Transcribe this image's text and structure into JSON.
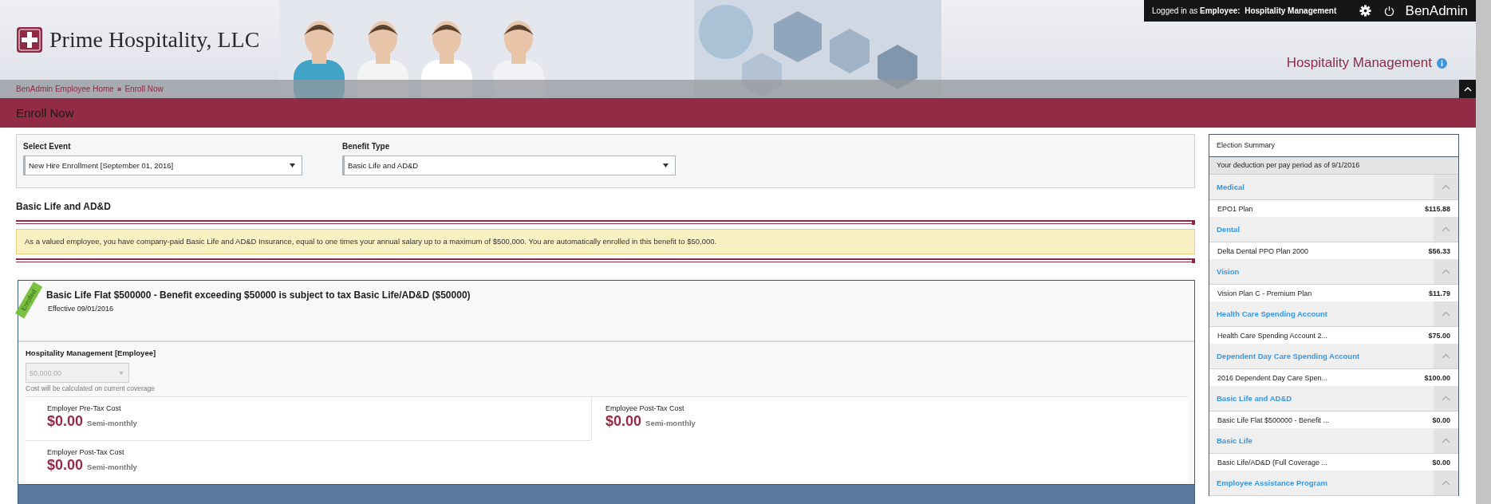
{
  "header": {
    "company": "Prime Hospitality, LLC",
    "login_prefix": "Logged in as",
    "login_role": "Employee:",
    "login_name": "Hospitality Management",
    "brand": "BenAdmin",
    "organization": "Hospitality Management"
  },
  "breadcrumb": {
    "separator": "»",
    "items": [
      {
        "label": "BenAdmin Employee Home"
      },
      {
        "label": "Enroll Now"
      }
    ]
  },
  "page_title": "Enroll Now",
  "filters": [
    {
      "label": "Select Event",
      "value": "New Hire Enrollment [September 01, 2016]"
    },
    {
      "label": "Benefit Type",
      "value": "Basic Life and AD&D"
    }
  ],
  "section_title": "Basic Life and AD&D",
  "notice": "As a valued employee, you have company-paid Basic Life and AD&D Insurance, equal to one times your annual salary up to a maximum of $500,000. You are automatically enrolled in this benefit to $50,000.",
  "plan": {
    "badge": "Enrolled",
    "title": "Basic Life Flat $500000 - Benefit exceeding $50000 is subject to tax Basic Life/AD&D ($50000)",
    "effective": "Effective 09/01/2016",
    "coverage_label": "Hospitality Management [Employee]",
    "coverage": {
      "value": "50,000.00",
      "disabled": true
    },
    "coverage_note": "Cost will be calculated on current coverage",
    "costs": [
      {
        "label": "Employer Pre-Tax Cost",
        "amount": "$0.00",
        "period": "Semi-monthly"
      },
      {
        "label": "Employee Post-Tax Cost",
        "amount": "$0.00",
        "period": "Semi-monthly"
      },
      {
        "label": "Employer Post-Tax Cost",
        "amount": "$0.00",
        "period": "Semi-monthly"
      }
    ]
  },
  "summary": {
    "title": "Election Summary",
    "subtitle": "Your deduction per pay period as of 9/1/2016",
    "groups": [
      {
        "name": "Medical",
        "expanded": true,
        "items": [
          {
            "name": "EPO1 Plan",
            "amount": "$115.88"
          }
        ]
      },
      {
        "name": "Dental",
        "expanded": true,
        "items": [
          {
            "name": "Delta Dental PPO Plan 2000",
            "amount": "$56.33"
          }
        ]
      },
      {
        "name": "Vision",
        "expanded": true,
        "items": [
          {
            "name": "Vision Plan C - Premium Plan",
            "amount": "$11.79"
          }
        ]
      },
      {
        "name": "Health Care Spending Account",
        "expanded": true,
        "items": [
          {
            "name": "Health Care Spending Account 2...",
            "amount": "$75.00"
          }
        ]
      },
      {
        "name": "Dependent Day Care Spending Account",
        "expanded": true,
        "items": [
          {
            "name": "2016 Dependent Day Care Spen...",
            "amount": "$100.00"
          }
        ]
      },
      {
        "name": "Basic Life and AD&D",
        "expanded": true,
        "items": [
          {
            "name": "Basic Life Flat $500000 - Benefit ...",
            "amount": "$0.00"
          }
        ]
      },
      {
        "name": "Basic Life",
        "expanded": true,
        "items": [
          {
            "name": "Basic Life/AD&D (Full Coverage ...",
            "amount": "$0.00"
          }
        ]
      },
      {
        "name": "Employee Assistance Program",
        "expanded": true
      }
    ]
  }
}
